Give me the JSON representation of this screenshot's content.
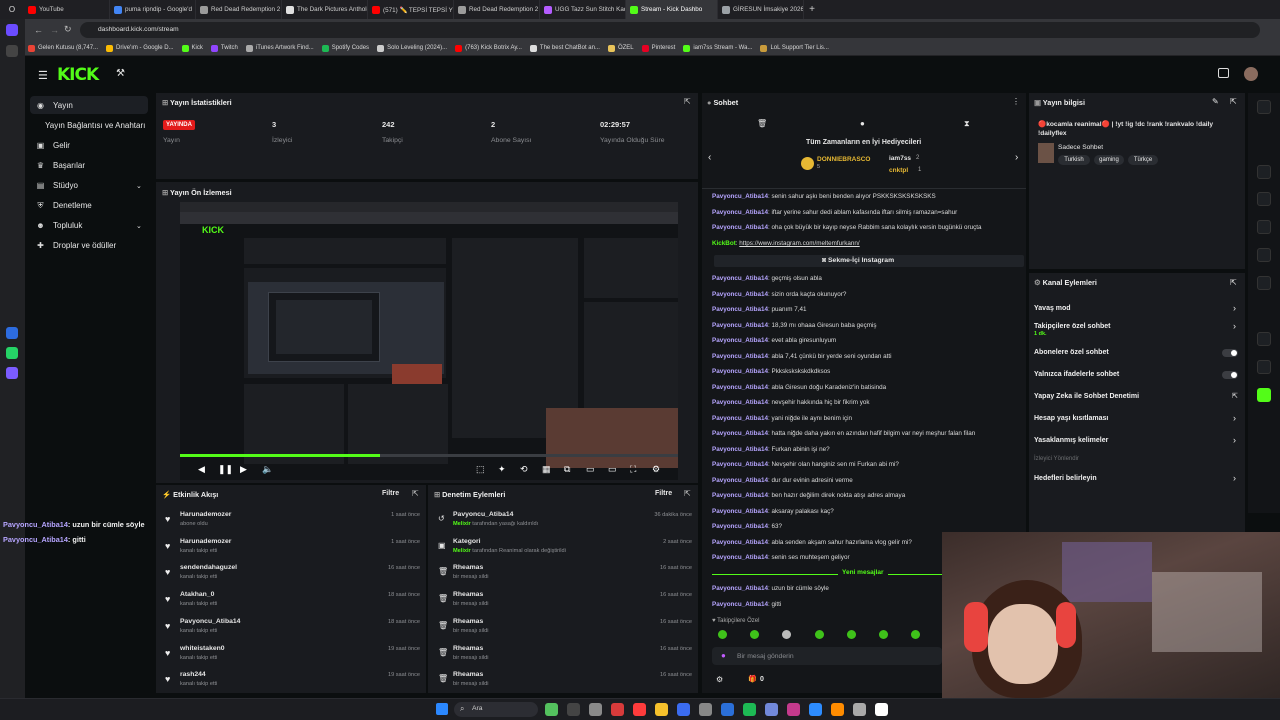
{
  "browser": {
    "tabs": [
      {
        "label": "YouTube",
        "color": "#ff0000"
      },
      {
        "label": "puma ripndip - Google'd",
        "color": "#4285f4"
      },
      {
        "label": "Red Dead Redemption 2",
        "color": "#9b9b9b"
      },
      {
        "label": "The Dark Pictures Antholo",
        "color": "#e0e0e0"
      },
      {
        "label": "(571) ✏️ TEPSİ TEPSİ YEDİ",
        "color": "#ff0000"
      },
      {
        "label": "Red Dead Redemption 2",
        "color": "#9b9b9b"
      },
      {
        "label": "UGG Tazz Sun Stitch Kadı",
        "color": "#b45cff"
      },
      {
        "label": "Stream - Kick Dashbo",
        "color": "#53fc18"
      },
      {
        "label": "GİRESUN İmsakiye 2026",
        "color": "#9ba1a6"
      }
    ],
    "url": "dashboard.kick.com/stream",
    "bookmarks": [
      {
        "label": "Gelen Kutusu (8,747...",
        "color": "#ea4335"
      },
      {
        "label": "Drive'ım - Google D...",
        "color": "#fbbc04"
      },
      {
        "label": "Kick",
        "color": "#53fc18"
      },
      {
        "label": "Twitch",
        "color": "#9146ff"
      },
      {
        "label": "iTunes Artwork Find...",
        "color": "#aaaaaa"
      },
      {
        "label": "Spotify Codes",
        "color": "#1db954"
      },
      {
        "label": "Solo Leveling (2024)...",
        "color": "#cccccc"
      },
      {
        "label": "(763) Kick Botrix Ay...",
        "color": "#ff0000"
      },
      {
        "label": "The best ChatBot an...",
        "color": "#dddddd"
      },
      {
        "label": "ÖZEL",
        "color": "#e8c35a"
      },
      {
        "label": "Pinterest",
        "color": "#e60023"
      },
      {
        "label": "iam7ss Stream - Wa...",
        "color": "#53fc18"
      },
      {
        "label": "LoL Support Tier Lis...",
        "color": "#c89b3c"
      }
    ]
  },
  "nav": {
    "items": [
      {
        "label": "Yayın",
        "icon": "broadcast-icon"
      },
      {
        "label": "Yayın Bağlantısı ve Anahtarı",
        "icon": ""
      },
      {
        "label": "Gelir",
        "icon": "money-icon"
      },
      {
        "label": "Başarılar",
        "icon": "trophy-icon"
      },
      {
        "label": "Stüdyo",
        "icon": "studio-icon"
      },
      {
        "label": "Denetleme",
        "icon": "shield-icon"
      },
      {
        "label": "Topluluk",
        "icon": "people-icon"
      },
      {
        "label": "Droplar ve ödüller",
        "icon": "gift-icon"
      }
    ]
  },
  "stats": {
    "title": "Yayın İstatistikleri",
    "badge": "YAYINDA",
    "items": [
      {
        "value": "",
        "label": "Yayın"
      },
      {
        "value": "3",
        "label": "İzleyici"
      },
      {
        "value": "242",
        "label": "Takipçi"
      },
      {
        "value": "2",
        "label": "Abone Sayısı"
      },
      {
        "value": "02:29:57",
        "label": "Yayında Olduğu Süre"
      }
    ]
  },
  "preview": {
    "title": "Yayın Ön İzlemesi"
  },
  "activity": {
    "title": "Etkinlik Akışı",
    "filter": "Filtre",
    "rows": [
      {
        "name": "Harunademozer",
        "sub": "abone oldu",
        "time": "1 saat önce"
      },
      {
        "name": "Harunademozer",
        "sub": "kanalı takip etti",
        "time": "1 saat önce"
      },
      {
        "name": "sendendahaguzel",
        "sub": "kanalı takip etti",
        "time": "16 saat önce"
      },
      {
        "name": "Atakhan_0",
        "sub": "kanalı takip etti",
        "time": "18 saat önce"
      },
      {
        "name": "Pavyoncu_Atiba14",
        "sub": "kanalı takip etti",
        "time": "18 saat önce"
      },
      {
        "name": "whiteistaken0",
        "sub": "kanalı takip etti",
        "time": "19 saat önce"
      },
      {
        "name": "rash244",
        "sub": "kanalı takip etti",
        "time": "19 saat önce"
      }
    ]
  },
  "moderation": {
    "title": "Denetim Eylemleri",
    "filter": "Filtre",
    "rows": [
      {
        "name": "Pavyoncu_Atiba14",
        "sub_user": "Melixir",
        "sub": "tarafından yasağı kaldırıldı",
        "time": "36 dakika önce"
      },
      {
        "name": "Kategori",
        "sub_user": "Melixir",
        "sub": "tarafından Reanimal olarak değiştirildi",
        "time": "2 saat önce"
      },
      {
        "name": "Rheamas",
        "sub_user": "",
        "sub": "bir mesajı sildi",
        "time": "16 saat önce"
      },
      {
        "name": "Rheamas",
        "sub_user": "",
        "sub": "bir mesajı sildi",
        "time": "16 saat önce"
      },
      {
        "name": "Rheamas",
        "sub_user": "",
        "sub": "bir mesajı sildi",
        "time": "16 saat önce"
      },
      {
        "name": "Rheamas",
        "sub_user": "",
        "sub": "bir mesajı sildi",
        "time": "16 saat önce"
      },
      {
        "name": "Rheamas",
        "sub_user": "",
        "sub": "bir mesajı sildi",
        "time": "16 saat önce"
      }
    ]
  },
  "chat": {
    "title": "Sohbet",
    "gifters_title": "Tüm Zamanların en İyi Hediyecileri",
    "gifters": [
      {
        "name": "DONNIEBRASCO",
        "count": "5"
      },
      {
        "name": "iam7ss",
        "count": "2"
      },
      {
        "name": "cnktpl",
        "count": "1"
      }
    ],
    "messages": [
      {
        "user": "Pavyoncu_Atiba14",
        "text": "senin sahur aşkı beni benden alıyor PSKKSKSKSKSKSKS"
      },
      {
        "user": "Pavyoncu_Atiba14",
        "text": "iftar yerine sahur dedi ablam kafasında iftarı silmiş ramazan=sahur"
      },
      {
        "user": "Pavyoncu_Atiba14",
        "text": "oha çok büyük bir kayıp neyse Rabbim sana kolaylık versin bugünkü oruçta"
      },
      {
        "user": "KickBot",
        "text": "https://www.instagram.com/meltemfurkann/"
      },
      {
        "user": "Pavyoncu_Atiba14",
        "text": "geçmiş olsun abla"
      },
      {
        "user": "Pavyoncu_Atiba14",
        "text": "sizin orda kaçta okunuyor?"
      },
      {
        "user": "Pavyoncu_Atiba14",
        "text": "puanım 7,41"
      },
      {
        "user": "Pavyoncu_Atiba14",
        "text": "18,39 mı ohaaa Giresun baba geçmiş"
      },
      {
        "user": "Pavyoncu_Atiba14",
        "text": "evet abla giresunluyum"
      },
      {
        "user": "Pavyoncu_Atiba14",
        "text": "abla 7,41 çünkü bir yerde seni oyundan atti"
      },
      {
        "user": "Pavyoncu_Atiba14",
        "text": "Pkkskskskskdkdksos"
      },
      {
        "user": "Pavyoncu_Atiba14",
        "text": "abla Giresun doğu Karadeniz'in batisinda"
      },
      {
        "user": "Pavyoncu_Atiba14",
        "text": "nevşehir hakkında hiç bir fikrim yok"
      },
      {
        "user": "Pavyoncu_Atiba14",
        "text": "yani niğde ile aynı benim için"
      },
      {
        "user": "Pavyoncu_Atiba14",
        "text": "hatta niğde daha yakın en azından hafif bilgim var neyi meşhur falan filan"
      },
      {
        "user": "Pavyoncu_Atiba14",
        "text": "Furkan abinin işi ne?"
      },
      {
        "user": "Pavyoncu_Atiba14",
        "text": "Nevşehir olan hanginiz sen mi Furkan abi mi?"
      },
      {
        "user": "Pavyoncu_Atiba14",
        "text": "dur dur evinin adresini verme"
      },
      {
        "user": "Pavyoncu_Atiba14",
        "text": "ben hazır değilim direk nokta atışı adres almaya"
      },
      {
        "user": "Pavyoncu_Atiba14",
        "text": "aksaray palakası kaç?"
      },
      {
        "user": "Pavyoncu_Atiba14",
        "text": "63?"
      },
      {
        "user": "Pavyoncu_Atiba14",
        "text": "abla senden akşam sahur hazırlama vlog gelir mi?"
      },
      {
        "user": "Pavyoncu_Atiba14",
        "text": "senin ses muhteşem geliyor"
      }
    ],
    "instagram_button": "Sekme-İçi Instagram",
    "new_messages": "Yeni mesajlar",
    "new": [
      {
        "user": "Pavyoncu_Atiba14",
        "text": "uzun bir cümle söyle"
      },
      {
        "user": "Pavyoncu_Atiba14",
        "text": "gitti"
      }
    ],
    "followers_only": "Takipçilere Özel",
    "input_placeholder": "Bir mesaj gönderin",
    "counter": "0"
  },
  "overlay_chat": [
    {
      "user": "Pavyoncu_Atiba14",
      "text": "uzun bir cümle söyle"
    },
    {
      "user": "Pavyoncu_Atiba14",
      "text": "gitti"
    }
  ],
  "stream_info": {
    "title": "Yayın bilgisi",
    "stream_title": "🔴kocamla reanimal🔴 | !yt !ig !dc !rank !rankvalo !daily !dailyflex",
    "category": "Sadece Sohbet",
    "tags": [
      "Turkish",
      "gaming",
      "Türkçe"
    ]
  },
  "channel_actions": {
    "title": "Kanal Eylemleri",
    "items": [
      {
        "label": "Yavaş mod",
        "type": "chevron"
      },
      {
        "label": "Takipçilere özel sohbet",
        "sub": "1 dk.",
        "type": "chevron"
      },
      {
        "label": "Abonelere özel sohbet",
        "type": "toggle"
      },
      {
        "label": "Yalnızca ifadelerle sohbet",
        "type": "toggle"
      },
      {
        "label": "Yapay Zeka ile Sohbet Denetimi",
        "type": "external"
      },
      {
        "label": "Hesap yaşı kısıtlaması",
        "type": "chevron"
      },
      {
        "label": "Yasaklanmış kelimeler",
        "type": "chevron"
      },
      {
        "label": "İzleyici Yönlendir",
        "type": "disabled"
      },
      {
        "label": "Hedefleri belirleyin",
        "type": "chevron"
      }
    ]
  },
  "taskbar": {
    "search": "Ara"
  }
}
